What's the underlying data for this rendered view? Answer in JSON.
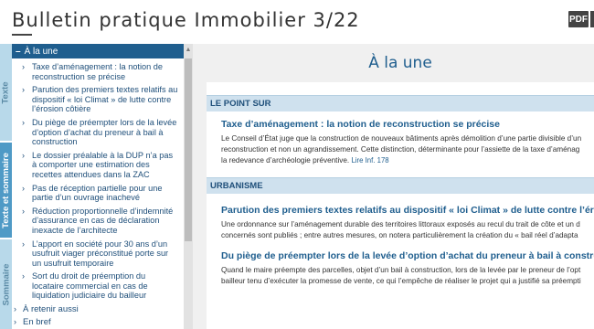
{
  "header": {
    "title": "Bulletin pratique Immobilier 3/22",
    "pdf_label": "PDF"
  },
  "vtabs": [
    {
      "label": "Texte"
    },
    {
      "label": "Texte et sommaire"
    },
    {
      "label": "Sommaire"
    }
  ],
  "sidebar": {
    "heading": "À la une",
    "items": [
      {
        "label": "Taxe d’aménagement : la notion de reconstruction se précise"
      },
      {
        "label": "Parution des premiers textes relatifs au dispositif « loi Climat » de lutte contre l’érosion côtière"
      },
      {
        "label": "Du piège de préempter lors de la levée d’option d’achat du preneur à bail à construction"
      },
      {
        "label": "Le dossier préalable à la DUP n’a pas à comporter une estimation des recettes attendues dans la ZAC"
      },
      {
        "label": "Pas de réception partielle pour une partie d’un ouvrage inachevé"
      },
      {
        "label": "Réduction proportionnelle d’indemnité d’assurance en cas de déclaration inexacte de l’architecte"
      },
      {
        "label": "L’apport en société pour 30 ans d’un usufruit viager préconstitué porte sur un usufruit temporaire"
      },
      {
        "label": "Sort du droit de préemption du locataire commercial en cas de liquidation judiciaire du bailleur"
      }
    ],
    "sections": [
      {
        "label": "À retenir aussi"
      },
      {
        "label": "En bref"
      }
    ]
  },
  "main": {
    "hero_title": "À la une",
    "sections": [
      {
        "name": "LE POINT SUR",
        "articles": [
          {
            "title": "Taxe d’aménagement : la notion de reconstruction se précise",
            "lines": [
              "Le Conseil d’État juge que la construction de nouveaux bâtiments après démolition d’une partie divisible d’un",
              "reconstruction et non un agrandissement. Cette distinction, déterminante pour l’assiette de la taxe d’aménag",
              "la redevance d’archéologie préventive."
            ],
            "link": "Lire Inf. 178"
          }
        ]
      },
      {
        "name": "URBANISME",
        "articles": [
          {
            "title": "Parution des premiers textes relatifs au dispositif « loi Climat » de lutte contre l’érosi",
            "lines": [
              "Une ordonnance sur l’aménagement durable des territoires littoraux exposés au recul du trait de côte et un d",
              "concernés sont publiés ; entre autres mesures, on notera particulièrement la création du « bail réel d’adapta"
            ]
          },
          {
            "title": "Du piège de préempter lors de la levée d’option d’achat du preneur à bail à construct",
            "lines": [
              "Quand le maire préempte des parcelles, objet d’un bail à construction, lors de la levée par le preneur de l’opt",
              "bailleur tenu d’exécuter la promesse de vente, ce qui l’empêche de réaliser le projet qui a justifié sa préempti"
            ]
          }
        ]
      }
    ]
  }
}
